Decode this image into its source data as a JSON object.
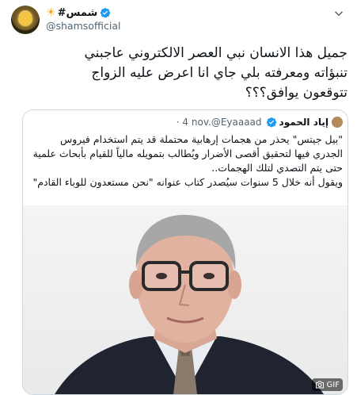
{
  "tweet": {
    "display_name": "#شمس",
    "handle": "@shamsofficial",
    "text_lines": [
      "جميل هذا الانسان نبي العصر الالكتروني  عاجبني",
      "تنبؤاته ومعرفته بلي جاي  انا اعرض عليه الزواج",
      "تتوقعون يوافق؟؟؟"
    ]
  },
  "quoted": {
    "display_name": "إياد الحمود",
    "handle": "@Eyaaaad",
    "date": "4 nov.",
    "text_lines": [
      "\"بيل جيتس\" يحذر من هجمات إرهابية محتملة قد يتم استخدام فيروس",
      "الجدري فيها لتحقيق أقصى الأضرار ويُطالب بتمويله مالياً للقيام بأبحاث علمية",
      "حتى يتم التصدي لتلك الهجمات..",
      "",
      "ويقول أنه خلال 5 سنوات سيُصدر كتاب عنوانه \"نحن مستعدون للوباء القادم\""
    ],
    "media_badge": "GIF"
  },
  "icons": [
    "sun-emoji",
    "verified-icon",
    "more-caret-icon",
    "camera-icon"
  ],
  "colors": {
    "verified": "#1d9bf0",
    "muted": "#536471",
    "border": "#cfd9de"
  }
}
